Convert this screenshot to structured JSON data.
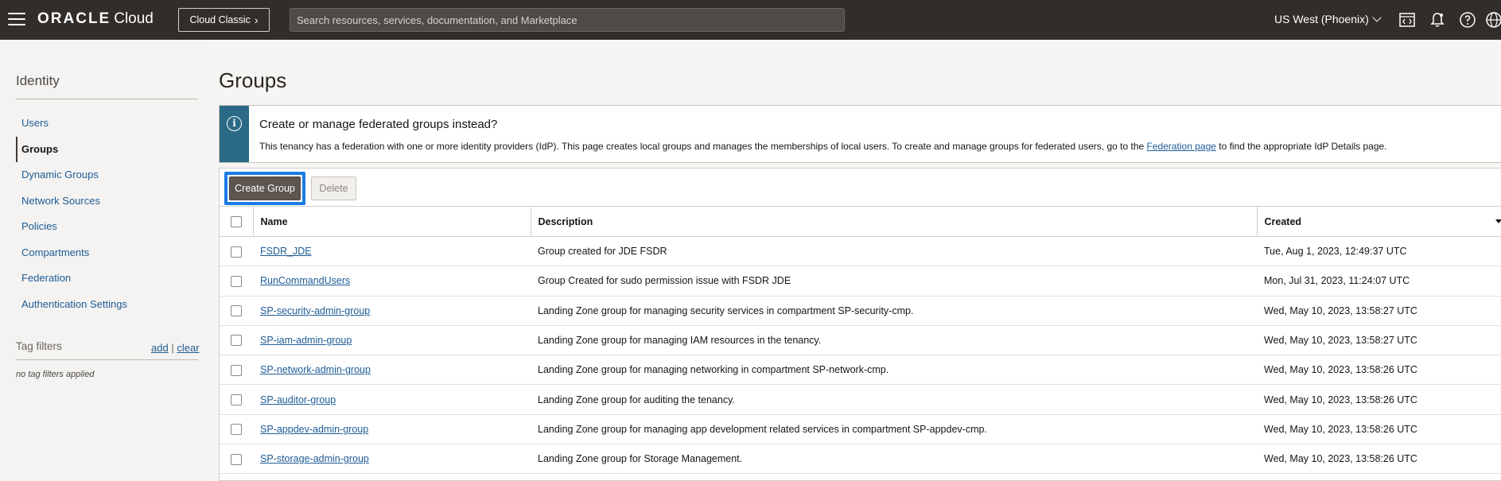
{
  "topbar": {
    "logo_brand": "ORACLE",
    "logo_product": "Cloud",
    "cloud_classic_label": "Cloud Classic",
    "search_placeholder": "Search resources, services, documentation, and Marketplace",
    "region": "US West (Phoenix)",
    "icons": [
      "menu-icon",
      "code-editor-icon",
      "bell-icon",
      "help-icon",
      "globe-icon"
    ]
  },
  "sidebar": {
    "title": "Identity",
    "items": [
      {
        "label": "Users",
        "active": false
      },
      {
        "label": "Groups",
        "active": true
      },
      {
        "label": "Dynamic Groups",
        "active": false
      },
      {
        "label": "Network Sources",
        "active": false
      },
      {
        "label": "Policies",
        "active": false
      },
      {
        "label": "Compartments",
        "active": false
      },
      {
        "label": "Federation",
        "active": false
      },
      {
        "label": "Authentication Settings",
        "active": false
      }
    ],
    "tag_filters": {
      "label": "Tag filters",
      "add": "add",
      "separator": "|",
      "clear": "clear",
      "empty": "no tag filters applied"
    }
  },
  "main": {
    "title": "Groups",
    "banner": {
      "title": "Create or manage federated groups instead?",
      "text_before": "This tenancy has a federation with one or more identity providers (IdP). This page creates local groups and manages the memberships of local users. To create and manage groups for federated users, go to the ",
      "link": "Federation page",
      "text_after": " to find the appropriate IdP Details page."
    },
    "toolbar": {
      "create_label": "Create Group",
      "delete_label": "Delete"
    },
    "table": {
      "columns": [
        "Name",
        "Description",
        "Created"
      ],
      "rows": [
        {
          "name": "FSDR_JDE",
          "description": "Group created for JDE FSDR",
          "created": "Tue, Aug 1, 2023, 12:49:37 UTC"
        },
        {
          "name": "RunCommandUsers",
          "description": "Group Created for sudo permission issue with FSDR JDE",
          "created": "Mon, Jul 31, 2023, 11:24:07 UTC"
        },
        {
          "name": "SP-security-admin-group",
          "description": "Landing Zone group for managing security services in compartment SP-security-cmp.",
          "created": "Wed, May 10, 2023, 13:58:27 UTC"
        },
        {
          "name": "SP-iam-admin-group",
          "description": "Landing Zone group for managing IAM resources in the tenancy.",
          "created": "Wed, May 10, 2023, 13:58:27 UTC"
        },
        {
          "name": "SP-network-admin-group",
          "description": "Landing Zone group for managing networking in compartment SP-network-cmp.",
          "created": "Wed, May 10, 2023, 13:58:26 UTC"
        },
        {
          "name": "SP-auditor-group",
          "description": "Landing Zone group for auditing the tenancy.",
          "created": "Wed, May 10, 2023, 13:58:26 UTC"
        },
        {
          "name": "SP-appdev-admin-group",
          "description": "Landing Zone group for managing app development related services in compartment SP-appdev-cmp.",
          "created": "Wed, May 10, 2023, 13:58:26 UTC"
        },
        {
          "name": "SP-storage-admin-group",
          "description": "Landing Zone group for Storage Management.",
          "created": "Wed, May 10, 2023, 13:58:26 UTC"
        }
      ]
    }
  },
  "colors": {
    "topbar": "#312d2a",
    "link": "#1e5b95",
    "banner_stripe": "#2b6a86",
    "focus_ring": "#1a7be4",
    "primary_button": "#5c5550"
  }
}
